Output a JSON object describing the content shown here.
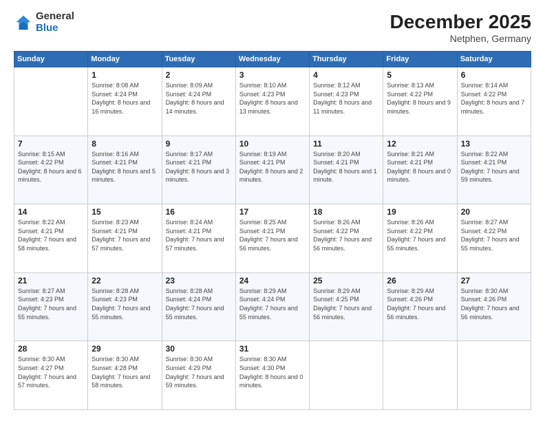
{
  "header": {
    "logo": {
      "line1": "General",
      "line2": "Blue"
    },
    "title": "December 2025",
    "subtitle": "Netphen, Germany"
  },
  "calendar": {
    "columns": [
      "Sunday",
      "Monday",
      "Tuesday",
      "Wednesday",
      "Thursday",
      "Friday",
      "Saturday"
    ],
    "weeks": [
      [
        {
          "day": null
        },
        {
          "day": "1",
          "sunrise": "Sunrise: 8:08 AM",
          "sunset": "Sunset: 4:24 PM",
          "daylight": "Daylight: 8 hours and 16 minutes."
        },
        {
          "day": "2",
          "sunrise": "Sunrise: 8:09 AM",
          "sunset": "Sunset: 4:24 PM",
          "daylight": "Daylight: 8 hours and 14 minutes."
        },
        {
          "day": "3",
          "sunrise": "Sunrise: 8:10 AM",
          "sunset": "Sunset: 4:23 PM",
          "daylight": "Daylight: 8 hours and 13 minutes."
        },
        {
          "day": "4",
          "sunrise": "Sunrise: 8:12 AM",
          "sunset": "Sunset: 4:23 PM",
          "daylight": "Daylight: 8 hours and 11 minutes."
        },
        {
          "day": "5",
          "sunrise": "Sunrise: 8:13 AM",
          "sunset": "Sunset: 4:22 PM",
          "daylight": "Daylight: 8 hours and 9 minutes."
        },
        {
          "day": "6",
          "sunrise": "Sunrise: 8:14 AM",
          "sunset": "Sunset: 4:22 PM",
          "daylight": "Daylight: 8 hours and 7 minutes."
        }
      ],
      [
        {
          "day": "7",
          "sunrise": "Sunrise: 8:15 AM",
          "sunset": "Sunset: 4:22 PM",
          "daylight": "Daylight: 8 hours and 6 minutes."
        },
        {
          "day": "8",
          "sunrise": "Sunrise: 8:16 AM",
          "sunset": "Sunset: 4:21 PM",
          "daylight": "Daylight: 8 hours and 5 minutes."
        },
        {
          "day": "9",
          "sunrise": "Sunrise: 8:17 AM",
          "sunset": "Sunset: 4:21 PM",
          "daylight": "Daylight: 8 hours and 3 minutes."
        },
        {
          "day": "10",
          "sunrise": "Sunrise: 8:19 AM",
          "sunset": "Sunset: 4:21 PM",
          "daylight": "Daylight: 8 hours and 2 minutes."
        },
        {
          "day": "11",
          "sunrise": "Sunrise: 8:20 AM",
          "sunset": "Sunset: 4:21 PM",
          "daylight": "Daylight: 8 hours and 1 minute."
        },
        {
          "day": "12",
          "sunrise": "Sunrise: 8:21 AM",
          "sunset": "Sunset: 4:21 PM",
          "daylight": "Daylight: 8 hours and 0 minutes."
        },
        {
          "day": "13",
          "sunrise": "Sunrise: 8:22 AM",
          "sunset": "Sunset: 4:21 PM",
          "daylight": "Daylight: 7 hours and 59 minutes."
        }
      ],
      [
        {
          "day": "14",
          "sunrise": "Sunrise: 8:22 AM",
          "sunset": "Sunset: 4:21 PM",
          "daylight": "Daylight: 7 hours and 58 minutes."
        },
        {
          "day": "15",
          "sunrise": "Sunrise: 8:23 AM",
          "sunset": "Sunset: 4:21 PM",
          "daylight": "Daylight: 7 hours and 57 minutes."
        },
        {
          "day": "16",
          "sunrise": "Sunrise: 8:24 AM",
          "sunset": "Sunset: 4:21 PM",
          "daylight": "Daylight: 7 hours and 57 minutes."
        },
        {
          "day": "17",
          "sunrise": "Sunrise: 8:25 AM",
          "sunset": "Sunset: 4:21 PM",
          "daylight": "Daylight: 7 hours and 56 minutes."
        },
        {
          "day": "18",
          "sunrise": "Sunrise: 8:26 AM",
          "sunset": "Sunset: 4:22 PM",
          "daylight": "Daylight: 7 hours and 56 minutes."
        },
        {
          "day": "19",
          "sunrise": "Sunrise: 8:26 AM",
          "sunset": "Sunset: 4:22 PM",
          "daylight": "Daylight: 7 hours and 55 minutes."
        },
        {
          "day": "20",
          "sunrise": "Sunrise: 8:27 AM",
          "sunset": "Sunset: 4:22 PM",
          "daylight": "Daylight: 7 hours and 55 minutes."
        }
      ],
      [
        {
          "day": "21",
          "sunrise": "Sunrise: 8:27 AM",
          "sunset": "Sunset: 4:23 PM",
          "daylight": "Daylight: 7 hours and 55 minutes."
        },
        {
          "day": "22",
          "sunrise": "Sunrise: 8:28 AM",
          "sunset": "Sunset: 4:23 PM",
          "daylight": "Daylight: 7 hours and 55 minutes."
        },
        {
          "day": "23",
          "sunrise": "Sunrise: 8:28 AM",
          "sunset": "Sunset: 4:24 PM",
          "daylight": "Daylight: 7 hours and 55 minutes."
        },
        {
          "day": "24",
          "sunrise": "Sunrise: 8:29 AM",
          "sunset": "Sunset: 4:24 PM",
          "daylight": "Daylight: 7 hours and 55 minutes."
        },
        {
          "day": "25",
          "sunrise": "Sunrise: 8:29 AM",
          "sunset": "Sunset: 4:25 PM",
          "daylight": "Daylight: 7 hours and 56 minutes."
        },
        {
          "day": "26",
          "sunrise": "Sunrise: 8:29 AM",
          "sunset": "Sunset: 4:26 PM",
          "daylight": "Daylight: 7 hours and 56 minutes."
        },
        {
          "day": "27",
          "sunrise": "Sunrise: 8:30 AM",
          "sunset": "Sunset: 4:26 PM",
          "daylight": "Daylight: 7 hours and 56 minutes."
        }
      ],
      [
        {
          "day": "28",
          "sunrise": "Sunrise: 8:30 AM",
          "sunset": "Sunset: 4:27 PM",
          "daylight": "Daylight: 7 hours and 57 minutes."
        },
        {
          "day": "29",
          "sunrise": "Sunrise: 8:30 AM",
          "sunset": "Sunset: 4:28 PM",
          "daylight": "Daylight: 7 hours and 58 minutes."
        },
        {
          "day": "30",
          "sunrise": "Sunrise: 8:30 AM",
          "sunset": "Sunset: 4:29 PM",
          "daylight": "Daylight: 7 hours and 59 minutes."
        },
        {
          "day": "31",
          "sunrise": "Sunrise: 8:30 AM",
          "sunset": "Sunset: 4:30 PM",
          "daylight": "Daylight: 8 hours and 0 minutes."
        },
        {
          "day": null
        },
        {
          "day": null
        },
        {
          "day": null
        }
      ]
    ]
  }
}
